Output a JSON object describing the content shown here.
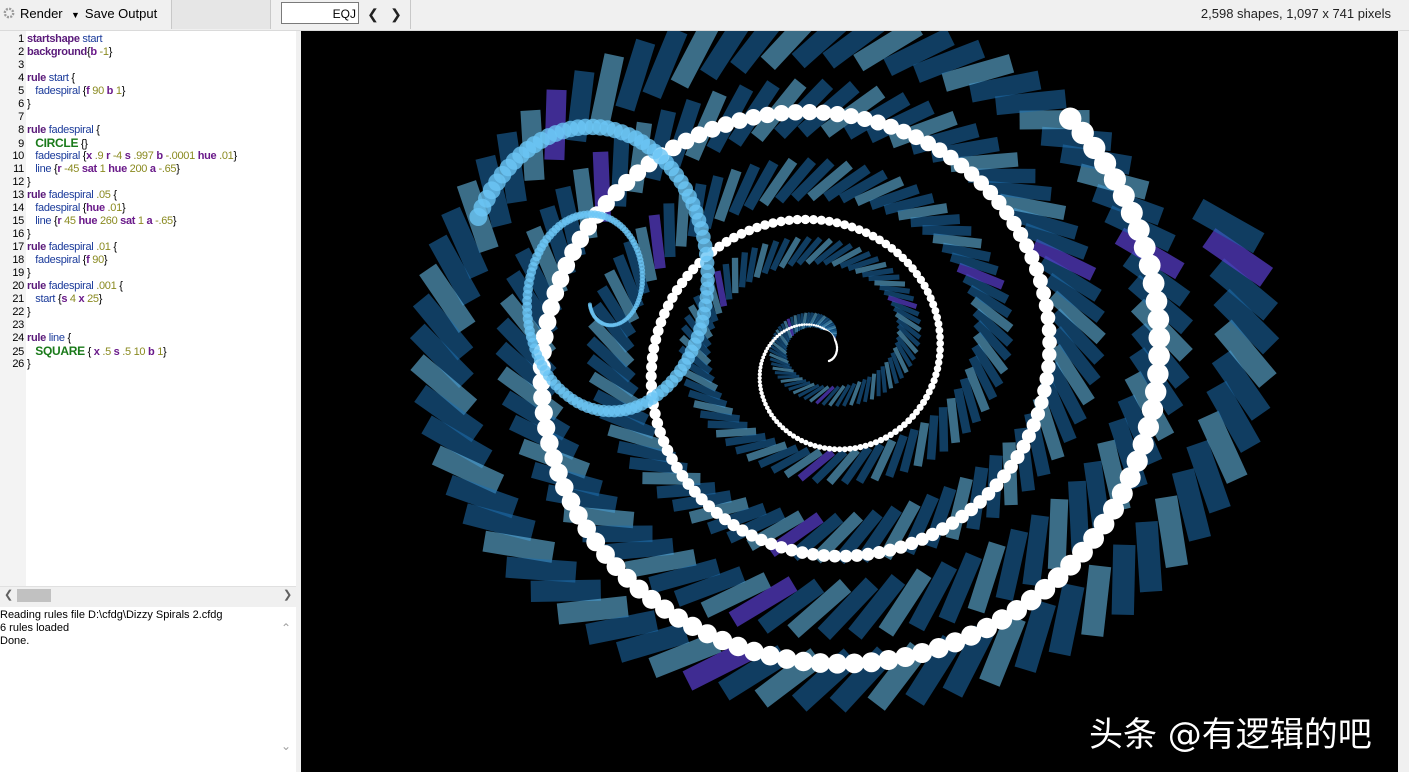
{
  "toolbar": {
    "render_label": "Render",
    "save_output_label": "Save Output",
    "file_name": "EQJ",
    "prev_icon": "chevron-left-icon",
    "next_icon": "chevron-right-icon",
    "status": "2,598 shapes, 1,097 x 741 pixels"
  },
  "editor": {
    "lines": [
      {
        "n": "1"
      },
      {
        "n": "2"
      },
      {
        "n": "3"
      },
      {
        "n": "4"
      },
      {
        "n": "5"
      },
      {
        "n": "6"
      },
      {
        "n": "7"
      },
      {
        "n": "8"
      },
      {
        "n": "9"
      },
      {
        "n": "10"
      },
      {
        "n": "11"
      },
      {
        "n": "12"
      },
      {
        "n": "13"
      },
      {
        "n": "14"
      },
      {
        "n": "15"
      },
      {
        "n": "16"
      },
      {
        "n": "17"
      },
      {
        "n": "18"
      },
      {
        "n": "19"
      },
      {
        "n": "20"
      },
      {
        "n": "21"
      },
      {
        "n": "22"
      },
      {
        "n": "23"
      },
      {
        "n": "24"
      },
      {
        "n": "25"
      },
      {
        "n": "26"
      }
    ],
    "t": {
      "startshape": "startshape",
      "start": "start",
      "background": "background",
      "b": "b",
      "m1": "-1",
      "rule": "rule",
      "fadespiral": "fadespiral",
      "f": "f",
      "n90": "90",
      "one": "1",
      "CIRCLE": "CIRCLE",
      "x": "x",
      "n9": ".9",
      "r": "r",
      "m4": "-4",
      "s": "s",
      "n997": ".997",
      "m0001": "-.0001",
      "hue": "hue",
      "n01": ".01",
      "line": "line",
      "m45": "-45",
      "sat": "sat",
      "n200": "200",
      "a": "a",
      "m65": "-.65",
      "n05": ".05",
      "n45": "45",
      "n260": "260",
      "n001": ".001",
      "n4": "4",
      "n25": "25",
      "SQUARE": "SQUARE",
      "n5": ".5",
      "n10": "10"
    }
  },
  "console": {
    "lines": [
      "Reading rules file D:\\cfdg\\Dizzy Spirals 2.cfdg",
      "6 rules loaded",
      "Done."
    ]
  },
  "watermark": "头条 @有逻辑的吧",
  "colors": {
    "canvas_bg": "#000000",
    "spiral_blue": "#1e6fb0",
    "spiral_cyan": "#6cc6f5",
    "spiral_purple": "#5a3fd0",
    "pearl": "#ffffff"
  }
}
